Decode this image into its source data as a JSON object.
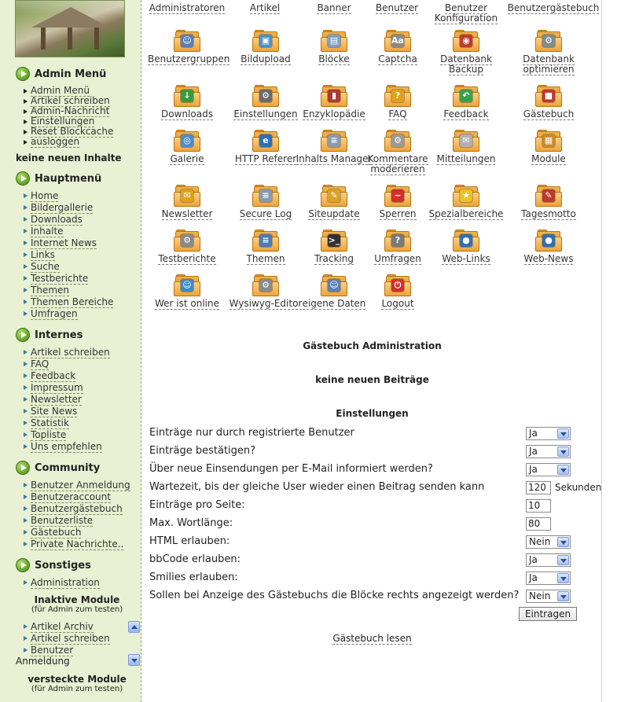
{
  "sidebar": {
    "admin_menu": {
      "title": "Admin Menü",
      "items": [
        "Admin Menü",
        "Artikel schreiben",
        "Admin-Nachricht",
        "Einstellungen",
        "Reset Blockcache",
        "ausloggen"
      ]
    },
    "no_new_content": "keine neuen Inhalte",
    "main_menu": {
      "title": "Hauptmenü",
      "items": [
        "Home",
        "Bildergallerie",
        "Downloads",
        "Inhalte",
        "Internet News",
        "Links",
        "Suche",
        "Testberichte",
        "Themen",
        "Themen Bereiche",
        "Umfragen"
      ]
    },
    "internal": {
      "title": "Internes",
      "items": [
        "Artikel schreiben",
        "FAQ",
        "Feedback",
        "Impressum",
        "Newsletter",
        "Site News",
        "Statistik",
        "Topliste",
        "Uns empfehlen"
      ]
    },
    "community": {
      "title": "Community",
      "items": [
        "Benutzer Anmeldung",
        "Benutzeraccount",
        "Benutzergästebuch",
        "Benutzerliste",
        "Gästebuch",
        "Private Nachrichte.."
      ]
    },
    "misc": {
      "title": "Sonstiges",
      "items": [
        "Administration"
      ]
    },
    "inactive_modules": {
      "title": "Inaktive Module",
      "subtitle": "(für Admin zum testen)",
      "items": [
        "Artikel Archiv",
        "Artikel schreiben",
        "Benutzer"
      ],
      "overflow": "Anmeldung"
    },
    "hidden_modules": {
      "title": "versteckte Module",
      "subtitle": "(für Admin zum testen)"
    }
  },
  "top_row": [
    "Administratoren",
    "Artikel",
    "Banner",
    "Benutzer",
    "Benutzer Konfiguration",
    "Benutzergästebuch"
  ],
  "admin_icons": [
    {
      "label": "Benutzergruppen",
      "icon": "users-icon",
      "color": "#5a7fb8"
    },
    {
      "label": "Bildupload",
      "icon": "image-upload-icon",
      "color": "#4a90c9"
    },
    {
      "label": "Blöcke",
      "icon": "blocks-icon",
      "color": "#7da0c8"
    },
    {
      "label": "Captcha",
      "icon": "captcha-icon",
      "color": "#8a8a8a"
    },
    {
      "label": "Datenbank Backup",
      "icon": "database-backup-icon",
      "color": "#c0392b"
    },
    {
      "label": "Datenbank optimieren",
      "icon": "database-optimize-icon",
      "color": "#7f8c8d"
    },
    {
      "label": "Downloads",
      "icon": "downloads-icon",
      "color": "#3a9a3a"
    },
    {
      "label": "Einstellungen",
      "icon": "settings-icon",
      "color": "#6b6b6b"
    },
    {
      "label": "Enzyklopädie",
      "icon": "encyclopedia-icon",
      "color": "#b03a2e"
    },
    {
      "label": "FAQ",
      "icon": "faq-icon",
      "color": "#e0a21a"
    },
    {
      "label": "Feedback",
      "icon": "feedback-icon",
      "color": "#3aa04a"
    },
    {
      "label": "Gästebuch",
      "icon": "guestbook-icon",
      "color": "#c0392b"
    },
    {
      "label": "Galerie",
      "icon": "gallery-icon",
      "color": "#4a8ec9"
    },
    {
      "label": "HTTP Referer",
      "icon": "http-referer-icon",
      "color": "#2e6fb8"
    },
    {
      "label": "Inhalts Manager",
      "icon": "content-manager-icon",
      "color": "#8a9bb0"
    },
    {
      "label": "Kommentare moderieren",
      "icon": "comments-icon",
      "color": "#9a9a9a"
    },
    {
      "label": "Mitteilungen",
      "icon": "messages-icon",
      "color": "#b0b0b0"
    },
    {
      "label": "Module",
      "icon": "modules-icon",
      "color": "#c98a2a"
    },
    {
      "label": "Newsletter",
      "icon": "newsletter-icon",
      "color": "#e0a21a"
    },
    {
      "label": "Secure Log",
      "icon": "secure-log-icon",
      "color": "#8a9bb0"
    },
    {
      "label": "Siteupdate",
      "icon": "siteupdate-icon",
      "color": "#d9a32a"
    },
    {
      "label": "Sperren",
      "icon": "block-user-icon",
      "color": "#d0302a"
    },
    {
      "label": "Spezialbereiche",
      "icon": "special-areas-icon",
      "color": "#e8c22a"
    },
    {
      "label": "Tagesmotto",
      "icon": "daily-motto-icon",
      "color": "#c0392b"
    },
    {
      "label": "Testberichte",
      "icon": "test-reports-icon",
      "color": "#8a8a8a"
    },
    {
      "label": "Themen",
      "icon": "topics-icon",
      "color": "#4a7ab8"
    },
    {
      "label": "Tracking",
      "icon": "tracking-icon",
      "color": "#333333"
    },
    {
      "label": "Umfragen",
      "icon": "polls-icon",
      "color": "#7a7a7a"
    },
    {
      "label": "Web-Links",
      "icon": "web-links-icon",
      "color": "#2e6fb8"
    },
    {
      "label": "Web-News",
      "icon": "web-news-icon",
      "color": "#2e6fb8"
    },
    {
      "label": "Wer ist online",
      "icon": "who-online-icon",
      "color": "#3a8ac9"
    },
    {
      "label": "Wysiwyg-Editor",
      "icon": "wysiwyg-editor-icon",
      "color": "#8a8a8a"
    },
    {
      "label": "eigene Daten",
      "icon": "own-data-icon",
      "color": "#5a7fb8"
    },
    {
      "label": "Logout",
      "icon": "logout-icon",
      "color": "#d0302a"
    }
  ],
  "guestbook": {
    "title": "Gästebuch Administration",
    "no_new_posts": "keine neuen Beiträge",
    "settings_title": "Einstellungen",
    "settings": [
      {
        "label": "Einträge nur durch registrierte Benutzer",
        "type": "select",
        "value": "Ja"
      },
      {
        "label": "Einträge bestätigen?",
        "type": "select",
        "value": "Ja"
      },
      {
        "label": "Über neue Einsendungen per E-Mail informiert werden?",
        "type": "select",
        "value": "Ja"
      },
      {
        "label": "Wartezeit, bis der gleiche User wieder einen Beitrag senden kann",
        "type": "text",
        "value": "120",
        "unit": "Sekunden"
      },
      {
        "label": "Einträge pro Seite:",
        "type": "text",
        "value": "10"
      },
      {
        "label": "Max. Wortlänge:",
        "type": "text",
        "value": "80"
      },
      {
        "label": "HTML erlauben:",
        "type": "select",
        "value": "Nein"
      },
      {
        "label": "bbCode erlauben:",
        "type": "select",
        "value": "Ja"
      },
      {
        "label": "Smilies erlauben:",
        "type": "select",
        "value": "Ja"
      },
      {
        "label": "Sollen bei Anzeige des Gästebuchs die Blöcke rechts angezeigt werden?",
        "type": "select",
        "value": "Nein"
      }
    ],
    "submit_label": "Eintragen",
    "read_link": "Gästebuch lesen"
  }
}
